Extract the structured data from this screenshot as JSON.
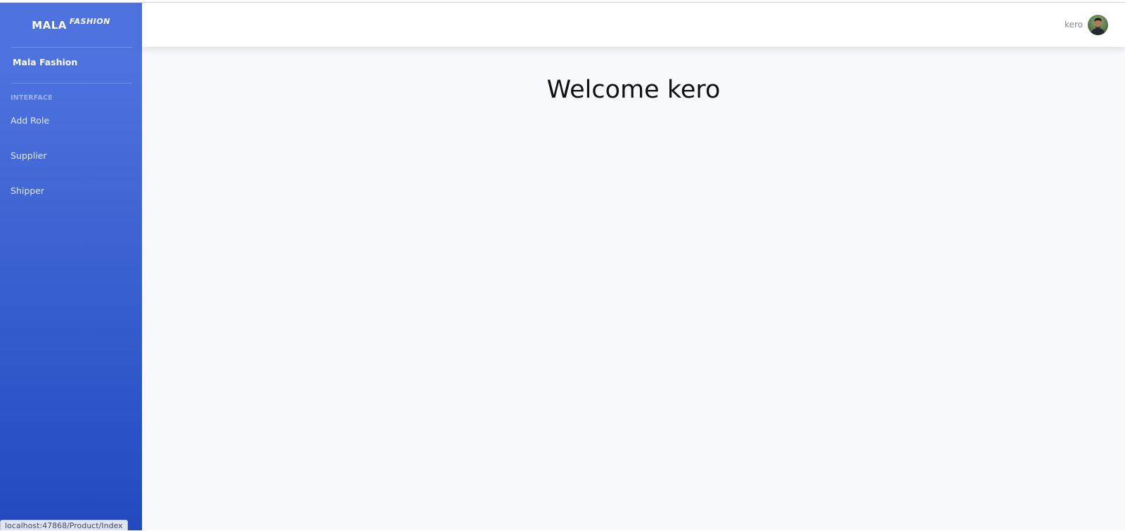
{
  "sidebar": {
    "brand_main": "Mala",
    "brand_sup": "Fashion",
    "dashboard_link": "Mala Fashion",
    "heading": "Interface",
    "items": [
      {
        "label": "Add Role"
      },
      {
        "label": "Supplier"
      },
      {
        "label": "Shipper"
      }
    ]
  },
  "topbar": {
    "user_name": "kero"
  },
  "main": {
    "welcome": "Welcome kero"
  },
  "status_bar": {
    "url": "localhost:47868/Product/Index"
  },
  "colors": {
    "sidebar_gradient_top": "#4e73df",
    "sidebar_gradient_bottom": "#224abe",
    "content_bg": "#f8f9fc"
  }
}
